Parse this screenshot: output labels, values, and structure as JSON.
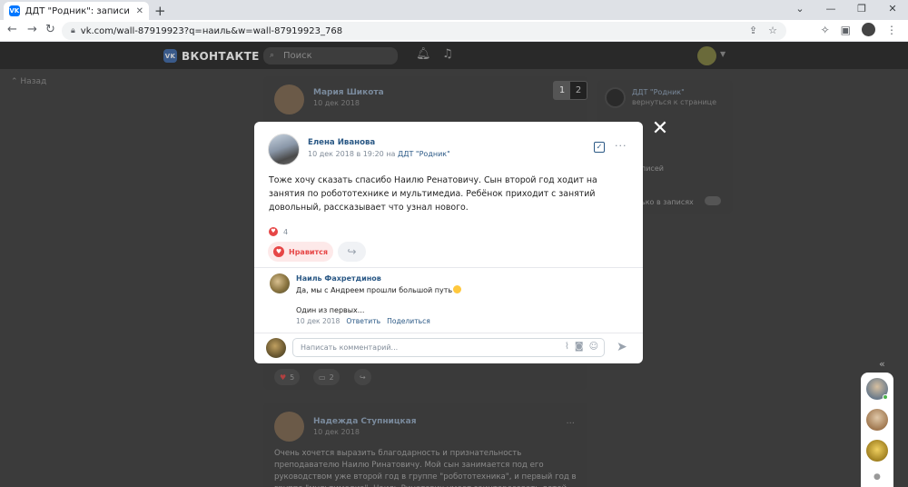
{
  "browser": {
    "tab_title": "ДДТ \"Родник\": записи сообщест",
    "tab_favicon_text": "VK",
    "tab_close": "✕",
    "new_tab": "+",
    "win_minimize": "—",
    "win_restore": "❐",
    "win_close": "✕",
    "url": "vk.com/wall-87919923?q=наиль&w=wall-87919923_768"
  },
  "vk_header": {
    "logo_text": "ВКОНТАКТЕ",
    "search_placeholder": "Поиск"
  },
  "background": {
    "back_link": "Назад",
    "page_switch": [
      "1",
      "2"
    ],
    "post1": {
      "author": "Мария Шикота",
      "date": "10 дек 2018"
    },
    "post2": {
      "author": "Надежда Ступницкая",
      "date": "10 дек 2018",
      "text": "Очень хочется выразить благодарность и признательность преподавателю Наилю Ринатовичу. Мой сын занимается под его руководством уже второй год в группе \"робототехника\", и первый год в группе \"мультимедиа\". Наиль Ринатович умеет заинтересовать детей, они с ним творят, развиваются и находят себя в..."
    },
    "actions": {
      "likes": "5",
      "comments": "2"
    },
    "side": {
      "group_name": "ДДТ \"Родник\"",
      "return_link": "вернуться к странице",
      "posts_label": "писей",
      "toggle_label": "ько в записях"
    }
  },
  "modal": {
    "close": "✕",
    "author": "Елена Иванова",
    "date": "10 дек 2018 в 19:20",
    "date_sep": " в ",
    "group": "ДДТ \"Родник\"",
    "text": "Тоже хочу сказать спасибо Наилю Ренатовичу. Сын второй год ходит на занятия по робототехнике и мультимедиа. Ребёнок приходит с занятий довольный, рассказывает что узнал нового.",
    "reactions_count": "4",
    "like_label": "Нравится",
    "comment": {
      "author": "Наиль Фахретдинов",
      "text_line1": "Да, мы с Андреем прошли большой путь",
      "text_line2": "Один из первых...",
      "date": "10 дек 2018",
      "reply": "Ответить",
      "share": "Поделиться"
    },
    "input_placeholder": "Написать комментарий..."
  }
}
